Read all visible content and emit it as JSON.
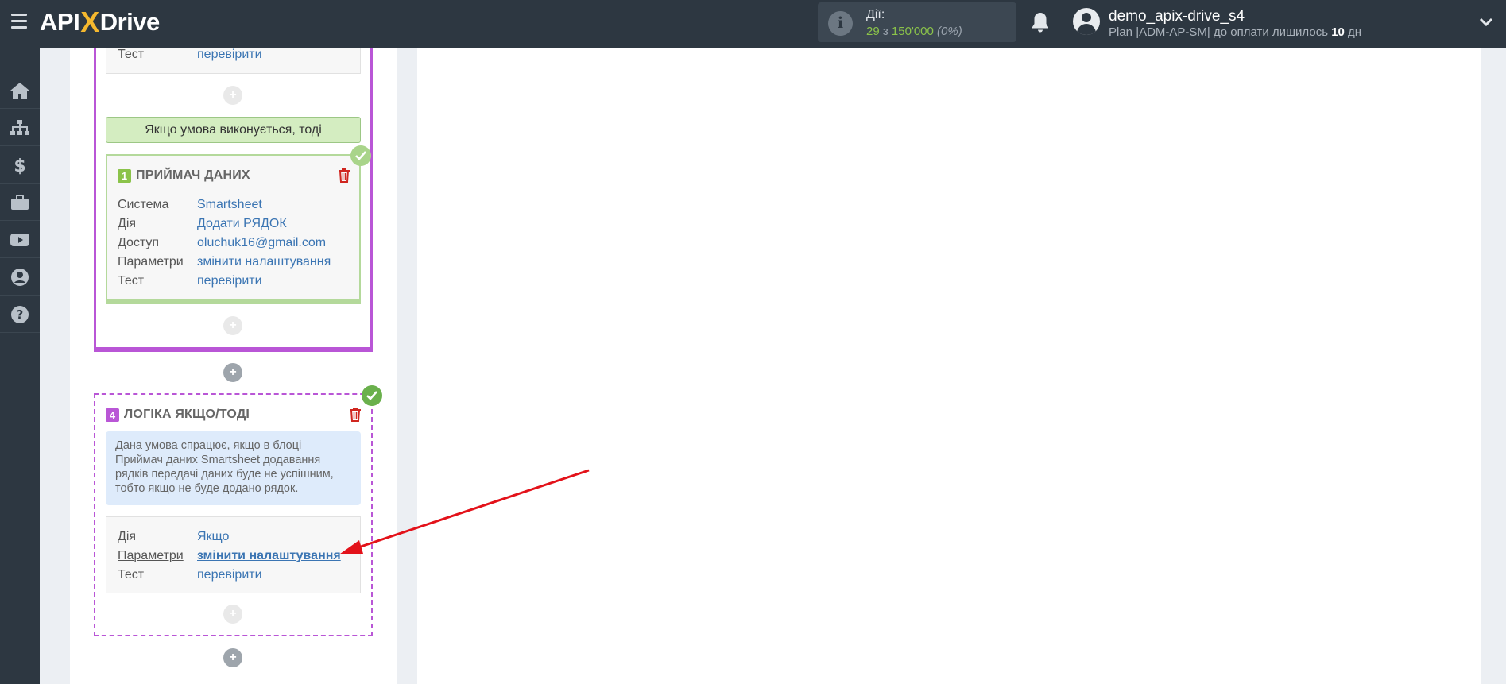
{
  "header": {
    "logo": {
      "left": "API",
      "x": "X",
      "right": "Drive"
    },
    "actions_label": "Дії:",
    "actions_used": "29",
    "actions_of": "з",
    "actions_total": "150'000",
    "actions_percent": "(0%)",
    "user_name": "demo_apix-drive_s4",
    "plan_text": "Plan |ADM-AP-SM| до оплати лишилось",
    "plan_days": "10",
    "plan_days_unit": "дн"
  },
  "sidebar": {
    "items": [
      {
        "icon": "home-icon"
      },
      {
        "icon": "sitemap-icon"
      },
      {
        "icon": "dollar-icon"
      },
      {
        "icon": "briefcase-icon"
      },
      {
        "icon": "youtube-icon"
      },
      {
        "icon": "user-icon"
      },
      {
        "icon": "help-icon"
      }
    ]
  },
  "top_block": {
    "test_label": "Тест",
    "test_value": "перевірити"
  },
  "condition_bar": "Якщо умова виконується, тоді",
  "receiver": {
    "number": "1",
    "title": "ПРИЙМАЧ ДАНИХ",
    "rows": [
      {
        "key": "Система",
        "value": "Smartsheet"
      },
      {
        "key": "Дія",
        "value": "Додати РЯДОК"
      },
      {
        "key": "Доступ",
        "value": "oluchuk16@gmail.com"
      },
      {
        "key": "Параметри",
        "value": "змінити налаштування"
      },
      {
        "key": "Тест",
        "value": "перевірити"
      }
    ]
  },
  "logic": {
    "number": "4",
    "title": "ЛОГІКА ЯКЩО/ТОДІ",
    "description": [
      "Дана умова спрацює, якщо в блоці",
      "Приймач даних Smartsheet додавання",
      "рядків передачі даних буде не успішним,",
      "тобто якщо не буде додано рядок."
    ],
    "rows": [
      {
        "key": "Дія",
        "value": "Якщо"
      },
      {
        "key": "Параметри",
        "value": "змінити налаштування"
      },
      {
        "key": "Тест",
        "value": "перевірити"
      }
    ]
  },
  "plus_symbol": "+",
  "colors": {
    "topbar": "#2d3741",
    "accent_green": "#8bc34a",
    "logo_x": "#f5b82e",
    "purple": "#b956d6",
    "link_blue": "#3b75b3",
    "annotation_red": "#e3121a"
  }
}
